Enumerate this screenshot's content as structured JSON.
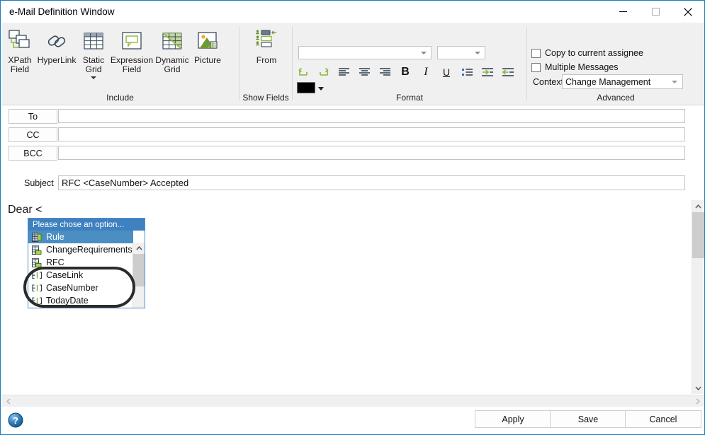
{
  "window": {
    "title": "e-Mail Definition Window",
    "minimize_label": "—",
    "maximize_label": "☐",
    "close_label": "✕"
  },
  "ribbon": {
    "groups": [
      {
        "name": "include",
        "label": "Include"
      },
      {
        "name": "show_fields",
        "label": "Show Fields"
      },
      {
        "name": "format",
        "label": "Format"
      },
      {
        "name": "advanced",
        "label": "Advanced"
      }
    ],
    "include_items": [
      {
        "icon": "xpath-field-icon",
        "line1": "XPath",
        "line2": "Field"
      },
      {
        "icon": "hyperlink-icon",
        "line1": "HyperLink",
        "line2": ""
      },
      {
        "icon": "static-grid-icon",
        "line1": "Static",
        "line2": "Grid"
      },
      {
        "icon": "expression-field-icon",
        "line1": "Expression",
        "line2": "Field"
      },
      {
        "icon": "dynamic-grid-icon",
        "line1": "Dynamic",
        "line2": "Grid"
      },
      {
        "icon": "picture-icon",
        "line1": "Picture",
        "line2": ""
      }
    ],
    "show_fields_items": [
      {
        "icon": "from-icon",
        "line1": "From",
        "line2": ""
      }
    ],
    "format": {
      "font_family_value": "",
      "font_size_value": "",
      "buttons": [
        {
          "name": "undo",
          "icon": "undo-arrow-icon"
        },
        {
          "name": "redo",
          "icon": "redo-arrow-icon"
        },
        {
          "name": "align-left",
          "icon": "align-left-icon"
        },
        {
          "name": "align-center",
          "icon": "align-center-icon"
        },
        {
          "name": "align-right",
          "icon": "align-right-icon"
        },
        {
          "name": "bold",
          "icon": "bold-icon",
          "glyph": "B"
        },
        {
          "name": "italic",
          "icon": "italic-icon",
          "glyph": "I"
        },
        {
          "name": "underline",
          "icon": "underline-icon",
          "glyph": "U"
        },
        {
          "name": "bullet-list",
          "icon": "bullet-list-icon"
        },
        {
          "name": "indent-increase",
          "icon": "indent-increase-icon"
        },
        {
          "name": "indent-decrease",
          "icon": "indent-decrease-icon"
        }
      ],
      "color_swatch": "#000000"
    },
    "advanced": {
      "copy_assignee_label": "Copy to current assignee",
      "copy_assignee_checked": false,
      "multiple_messages_label": "Multiple Messages",
      "multiple_messages_checked": false,
      "context_label": "Context",
      "context_value": "Change Management"
    }
  },
  "address": {
    "to_label": "To",
    "to_value": "",
    "cc_label": "CC",
    "cc_value": "",
    "bcc_label": "BCC",
    "bcc_value": "",
    "subject_label": "Subject",
    "subject_value": "RFC <CaseNumber> Accepted"
  },
  "body": {
    "text": "Dear <"
  },
  "dropdown": {
    "header": "Please chose an option...",
    "items": [
      {
        "label": "Rule",
        "icon": "rule-grid-icon",
        "selected": true
      },
      {
        "label": "ChangeRequirements",
        "icon": "grid-field-icon",
        "selected": false
      },
      {
        "label": "RFC",
        "icon": "grid-field-icon",
        "selected": false
      },
      {
        "label": "CaseLink",
        "icon": "text-field-icon",
        "selected": false
      },
      {
        "label": "CaseNumber",
        "icon": "text-field-icon",
        "selected": false
      },
      {
        "label": "TodayDate",
        "icon": "text-field-icon",
        "selected": false
      }
    ]
  },
  "footer": {
    "help_icon": "help-question-icon",
    "apply_label": "Apply",
    "save_label": "Save",
    "cancel_label": "Cancel"
  },
  "scrollbars": {
    "v_up": "▲",
    "v_down": "▼",
    "h_left": "‹",
    "h_right": "›"
  },
  "colors": {
    "accent": "#1a7bc4",
    "ribbon_bg": "#f0f0f0",
    "select_blue": "#4a8ec2",
    "header_blue": "#3f80bf",
    "green": "#8cb63c"
  }
}
